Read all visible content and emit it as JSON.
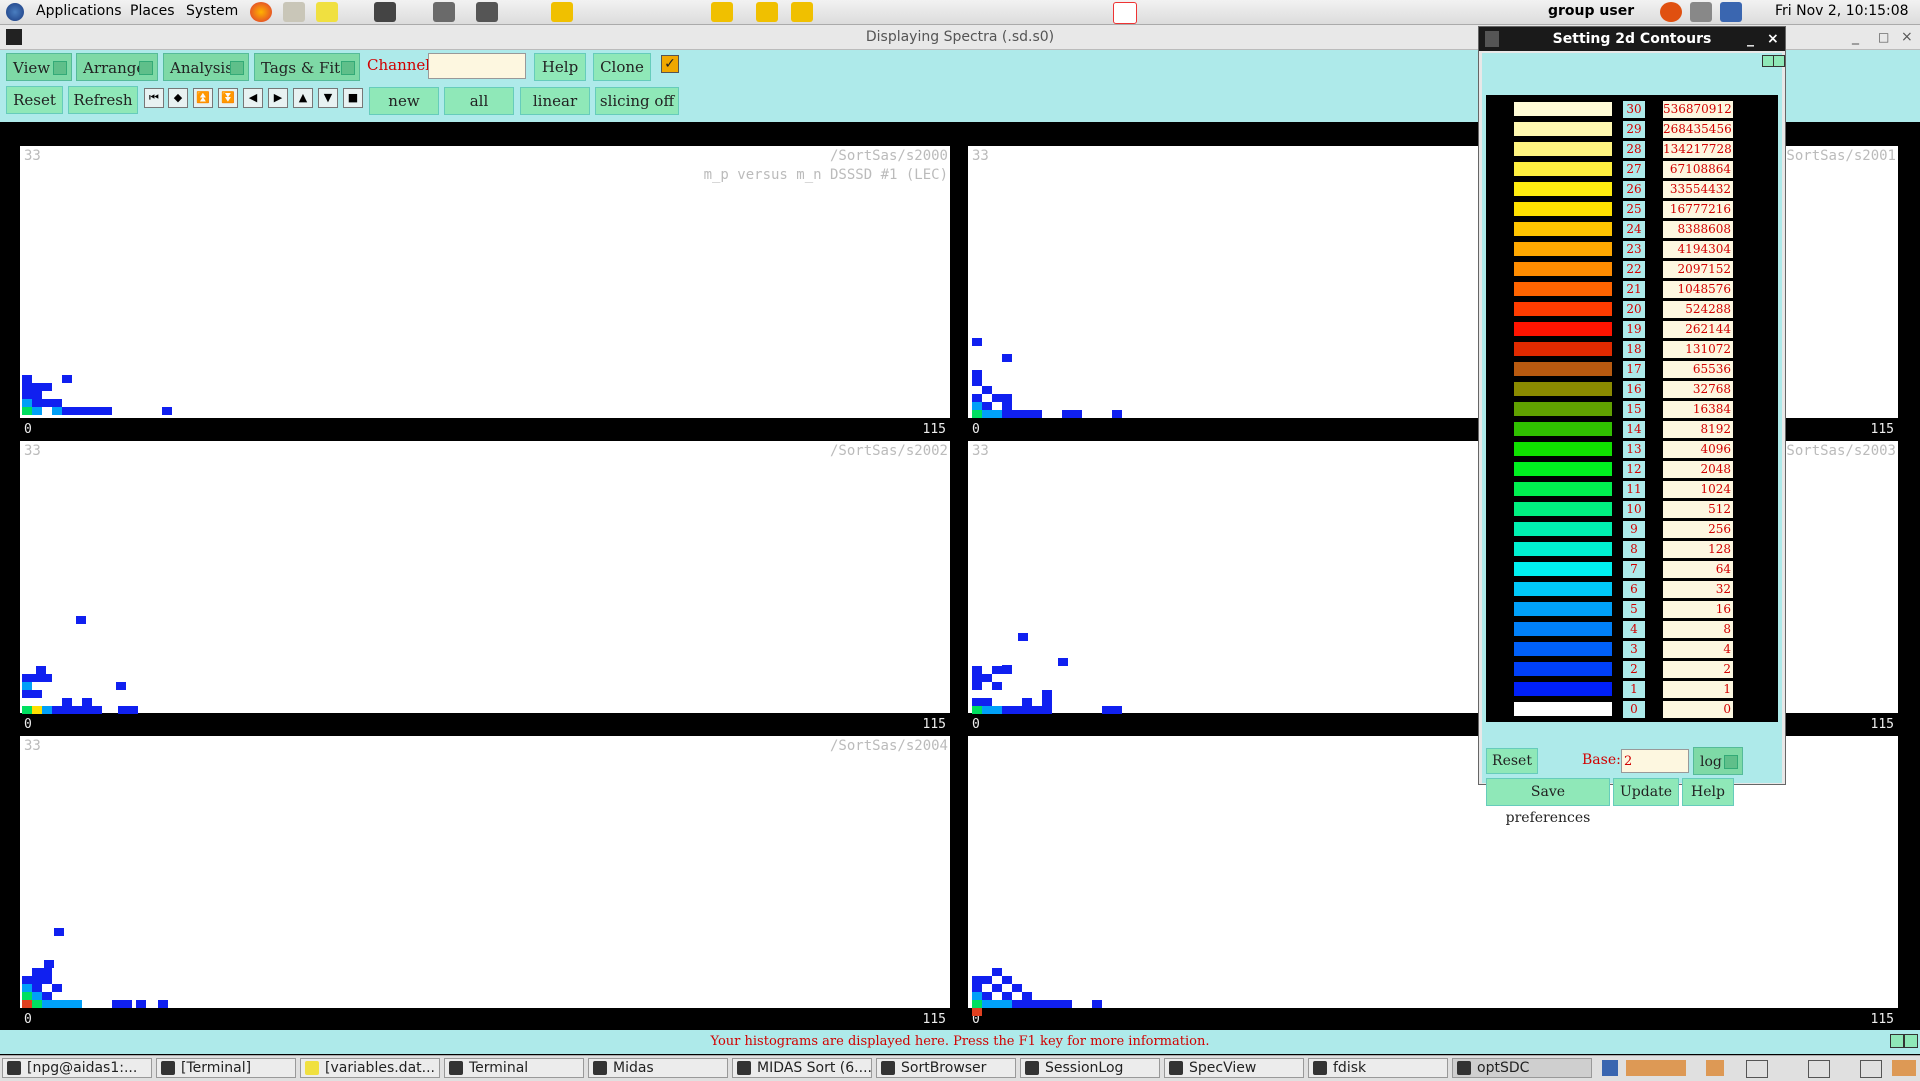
{
  "topbar": {
    "applications": "Applications",
    "places": "Places",
    "system": "System",
    "user": "group user",
    "clock": "Fri Nov  2, 10:15:08"
  },
  "window": {
    "title": "Displaying Spectra (.sd.s0)"
  },
  "toolbar": {
    "view": "View",
    "arrange": "Arrange",
    "analysis": "Analysis",
    "tags_fits": "Tags & Fits",
    "channel_label": "Channel:",
    "channel_value": "",
    "help": "Help",
    "clone": "Clone",
    "reset": "Reset",
    "refresh": "Refresh",
    "new": "new",
    "all": "all",
    "linear": "linear",
    "slicing": "slicing off"
  },
  "panels": [
    {
      "ymax": "33",
      "path": "/SortSas/s2000",
      "subtitle": "m_p versus m_n DSSSD #1 (LEC)",
      "xmin": "0",
      "xmax": "115"
    },
    {
      "ymax": "33",
      "path": "/SortSas/s2001",
      "subtitle": "",
      "xmin": "0",
      "xmax": "115"
    },
    {
      "ymax": "33",
      "path": "/SortSas/s2002",
      "subtitle": "",
      "xmin": "0",
      "xmax": "115"
    },
    {
      "ymax": "33",
      "path": "/SortSas/s2003",
      "subtitle": "",
      "xmin": "0",
      "xmax": "115"
    },
    {
      "ymax": "33",
      "path": "/SortSas/s2004",
      "subtitle": "",
      "xmin": "0",
      "xmax": "115"
    },
    {
      "ymax": "",
      "path": "",
      "subtitle": "",
      "xmin": "0",
      "xmax": "115"
    }
  ],
  "status": {
    "message": "Your histograms are displayed here. Press the F1 key for more information."
  },
  "dialog": {
    "title": "Setting 2d Contours",
    "reset": "Reset",
    "base_label": "Base:",
    "base_value": "2",
    "scale": "log",
    "save": "Save preferences",
    "update": "Update",
    "help": "Help",
    "levels": [
      {
        "i": "30",
        "v": "536870912",
        "c": "#fffbd6"
      },
      {
        "i": "29",
        "v": "268435456",
        "c": "#fff8b0"
      },
      {
        "i": "28",
        "v": "134217728",
        "c": "#fff480"
      },
      {
        "i": "27",
        "v": "67108864",
        "c": "#ffef40"
      },
      {
        "i": "26",
        "v": "33554432",
        "c": "#ffec10"
      },
      {
        "i": "25",
        "v": "16777216",
        "c": "#ffe000"
      },
      {
        "i": "24",
        "v": "8388608",
        "c": "#ffc400"
      },
      {
        "i": "23",
        "v": "4194304",
        "c": "#ffa800"
      },
      {
        "i": "22",
        "v": "2097152",
        "c": "#ff8c00"
      },
      {
        "i": "21",
        "v": "1048576",
        "c": "#ff6400"
      },
      {
        "i": "20",
        "v": "524288",
        "c": "#ff3c00"
      },
      {
        "i": "19",
        "v": "262144",
        "c": "#ff1400"
      },
      {
        "i": "18",
        "v": "131072",
        "c": "#e02a00"
      },
      {
        "i": "17",
        "v": "65536",
        "c": "#b85a10"
      },
      {
        "i": "16",
        "v": "32768",
        "c": "#8a8a00"
      },
      {
        "i": "15",
        "v": "16384",
        "c": "#60a000"
      },
      {
        "i": "14",
        "v": "8192",
        "c": "#30c000"
      },
      {
        "i": "13",
        "v": "4096",
        "c": "#10e000"
      },
      {
        "i": "12",
        "v": "2048",
        "c": "#00f020"
      },
      {
        "i": "11",
        "v": "1024",
        "c": "#00f050"
      },
      {
        "i": "10",
        "v": "512",
        "c": "#00f080"
      },
      {
        "i": "9",
        "v": "256",
        "c": "#00f0b0"
      },
      {
        "i": "8",
        "v": "128",
        "c": "#00f0d0"
      },
      {
        "i": "7",
        "v": "64",
        "c": "#00f0f0"
      },
      {
        "i": "6",
        "v": "32",
        "c": "#00c8f8"
      },
      {
        "i": "5",
        "v": "16",
        "c": "#00a0f8"
      },
      {
        "i": "4",
        "v": "8",
        "c": "#0080f8"
      },
      {
        "i": "3",
        "v": "4",
        "c": "#0060f8"
      },
      {
        "i": "2",
        "v": "2",
        "c": "#0040f8"
      },
      {
        "i": "1",
        "v": "1",
        "c": "#0020f8"
      },
      {
        "i": "0",
        "v": "0",
        "c": "#ffffff"
      }
    ]
  },
  "taskbar": [
    "[npg@aidas1:...",
    "[Terminal]",
    "[variables.dat...",
    "Terminal",
    "Midas",
    "MIDAS Sort (6....",
    "SortBrowser",
    "SessionLog",
    "SpecView",
    "fdisk",
    "optSDC"
  ]
}
